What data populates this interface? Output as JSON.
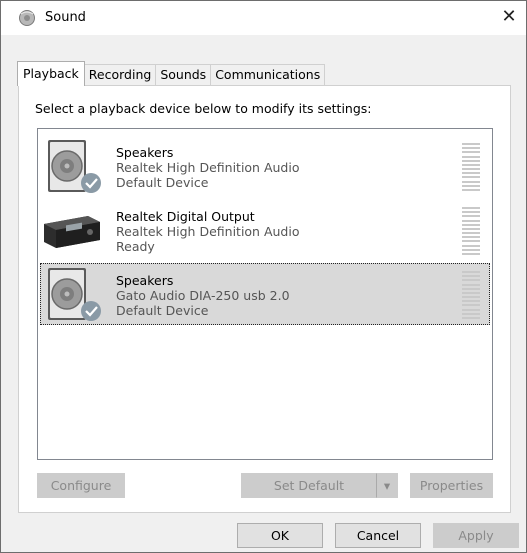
{
  "window": {
    "title": "Sound",
    "close_glyph": "✕",
    "icon": "speaker-icon"
  },
  "tabs": [
    {
      "label": "Playback",
      "active": true
    },
    {
      "label": "Recording",
      "active": false
    },
    {
      "label": "Sounds",
      "active": false
    },
    {
      "label": "Communications",
      "active": false
    }
  ],
  "playback": {
    "instruction": "Select a playback device below to modify its settings:",
    "devices": [
      {
        "name": "Speakers",
        "driver": "Realtek High Definition Audio",
        "status": "Default Device",
        "icon": "speaker-icon",
        "default": true,
        "selected": false
      },
      {
        "name": "Realtek Digital Output",
        "driver": "Realtek High Definition Audio",
        "status": "Ready",
        "icon": "receiver-icon",
        "default": false,
        "selected": false
      },
      {
        "name": "Speakers",
        "driver": "Gato Audio DIA-250 usb 2.0",
        "status": "Default Device",
        "icon": "speaker-icon",
        "default": true,
        "selected": true
      }
    ],
    "buttons": {
      "configure": "Configure",
      "set_default": "Set Default",
      "set_default_arrow": "▾",
      "properties": "Properties"
    }
  },
  "dialog_buttons": {
    "ok": "OK",
    "cancel": "Cancel",
    "apply": "Apply"
  },
  "colors": {
    "selection": "#d9d9d9",
    "check_badge": "#8a9aa6"
  }
}
